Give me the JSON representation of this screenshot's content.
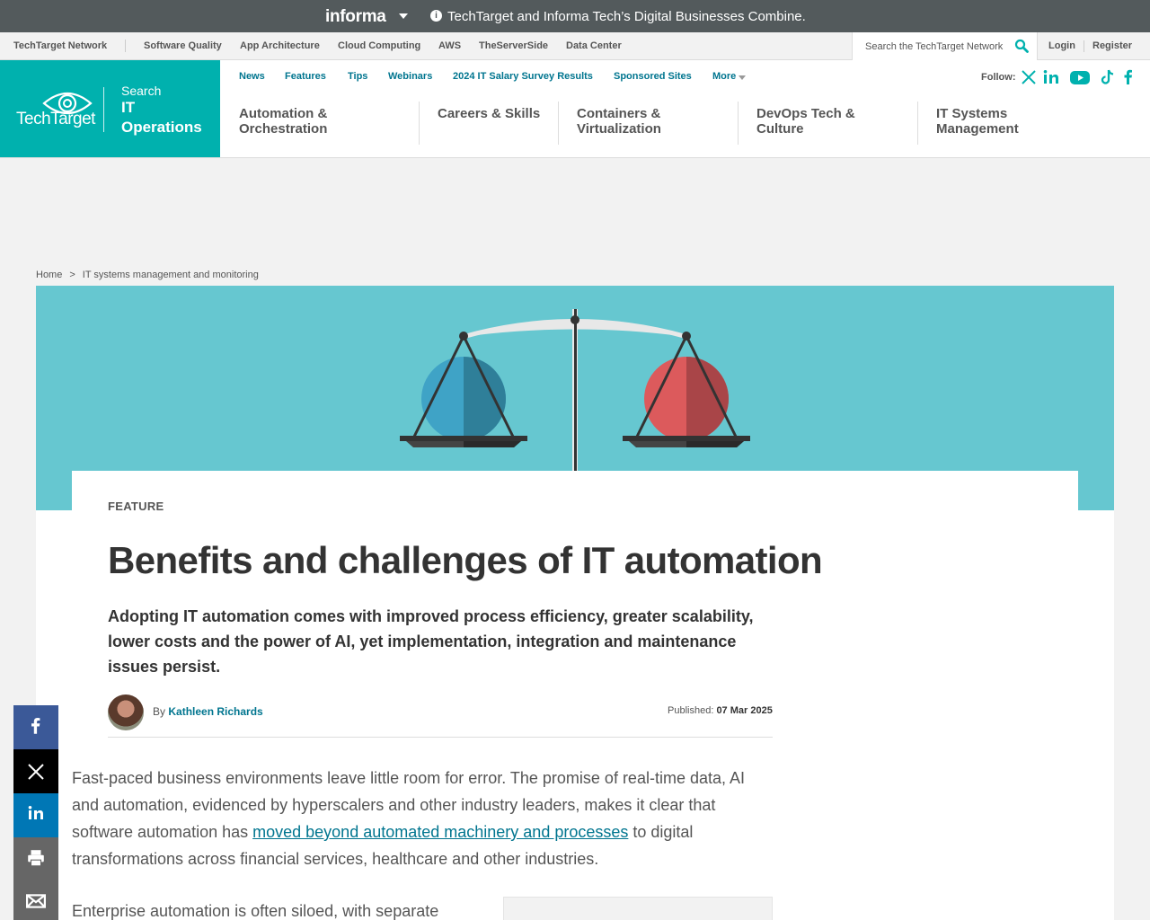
{
  "informa_bar": {
    "logo": "informa",
    "message": "TechTarget and Informa Tech’s Digital Businesses Combine."
  },
  "network_bar": {
    "network_label": "TechTarget Network",
    "links": [
      "Software Quality",
      "App Architecture",
      "Cloud Computing",
      "AWS",
      "TheServerSide",
      "Data Center"
    ],
    "search_placeholder": "Search the TechTarget Network",
    "login": "Login",
    "register": "Register"
  },
  "brand": {
    "logo_text": "TechTarget",
    "search_label": "Search",
    "site_name": "IT Operations",
    "color": "#00b1ae"
  },
  "top_nav": {
    "links": [
      "News",
      "Features",
      "Tips",
      "Webinars",
      "2024 IT Salary Survey Results",
      "Sponsored Sites",
      "More"
    ],
    "follow_label": "Follow:",
    "social_icons": [
      "x-icon",
      "linkedin-icon",
      "youtube-icon",
      "tiktok-icon",
      "facebook-icon"
    ]
  },
  "topics": [
    "Automation & Orchestration",
    "Careers & Skills",
    "Containers & Virtualization",
    "DevOps Tech & Culture",
    "IT Systems Management"
  ],
  "breadcrumb": {
    "home": "Home",
    "separator": ">",
    "section": "IT systems management and monitoring"
  },
  "hero": {
    "image_name": "balance-scale-illustration",
    "background_color": "#66c7d0"
  },
  "article": {
    "kicker": "FEATURE",
    "title": "Benefits and challenges of IT automation",
    "dek": "Adopting IT automation comes with improved process efficiency, greater scalability, lower costs and the power of AI, yet implementation, integration and maintenance issues persist.",
    "by_label": "By",
    "author": "Kathleen Richards",
    "published_label": "Published:",
    "published_date": "07 Mar 2025",
    "para1_before": "Fast-paced business environments leave little room for error. The promise of real-time data, AI and automation, evidenced by hyperscalers and other industry leaders, makes it clear that software automation has ",
    "para1_link": "moved beyond automated machinery and processes",
    "para1_after": " to digital transformations across financial services, healthcare and other industries.",
    "para2_start": "Enterprise automation is often siloed, with separate"
  },
  "share_rail": {
    "items": [
      "facebook-icon",
      "x-icon",
      "linkedin-icon",
      "print-icon",
      "email-icon"
    ],
    "colors": {
      "facebook": "#3b5998",
      "x": "#000000",
      "linkedin": "#0077b5",
      "print": "#666666",
      "email": "#666666"
    }
  },
  "colors": {
    "link": "#00758f",
    "informa_bar": "#535a5c"
  }
}
